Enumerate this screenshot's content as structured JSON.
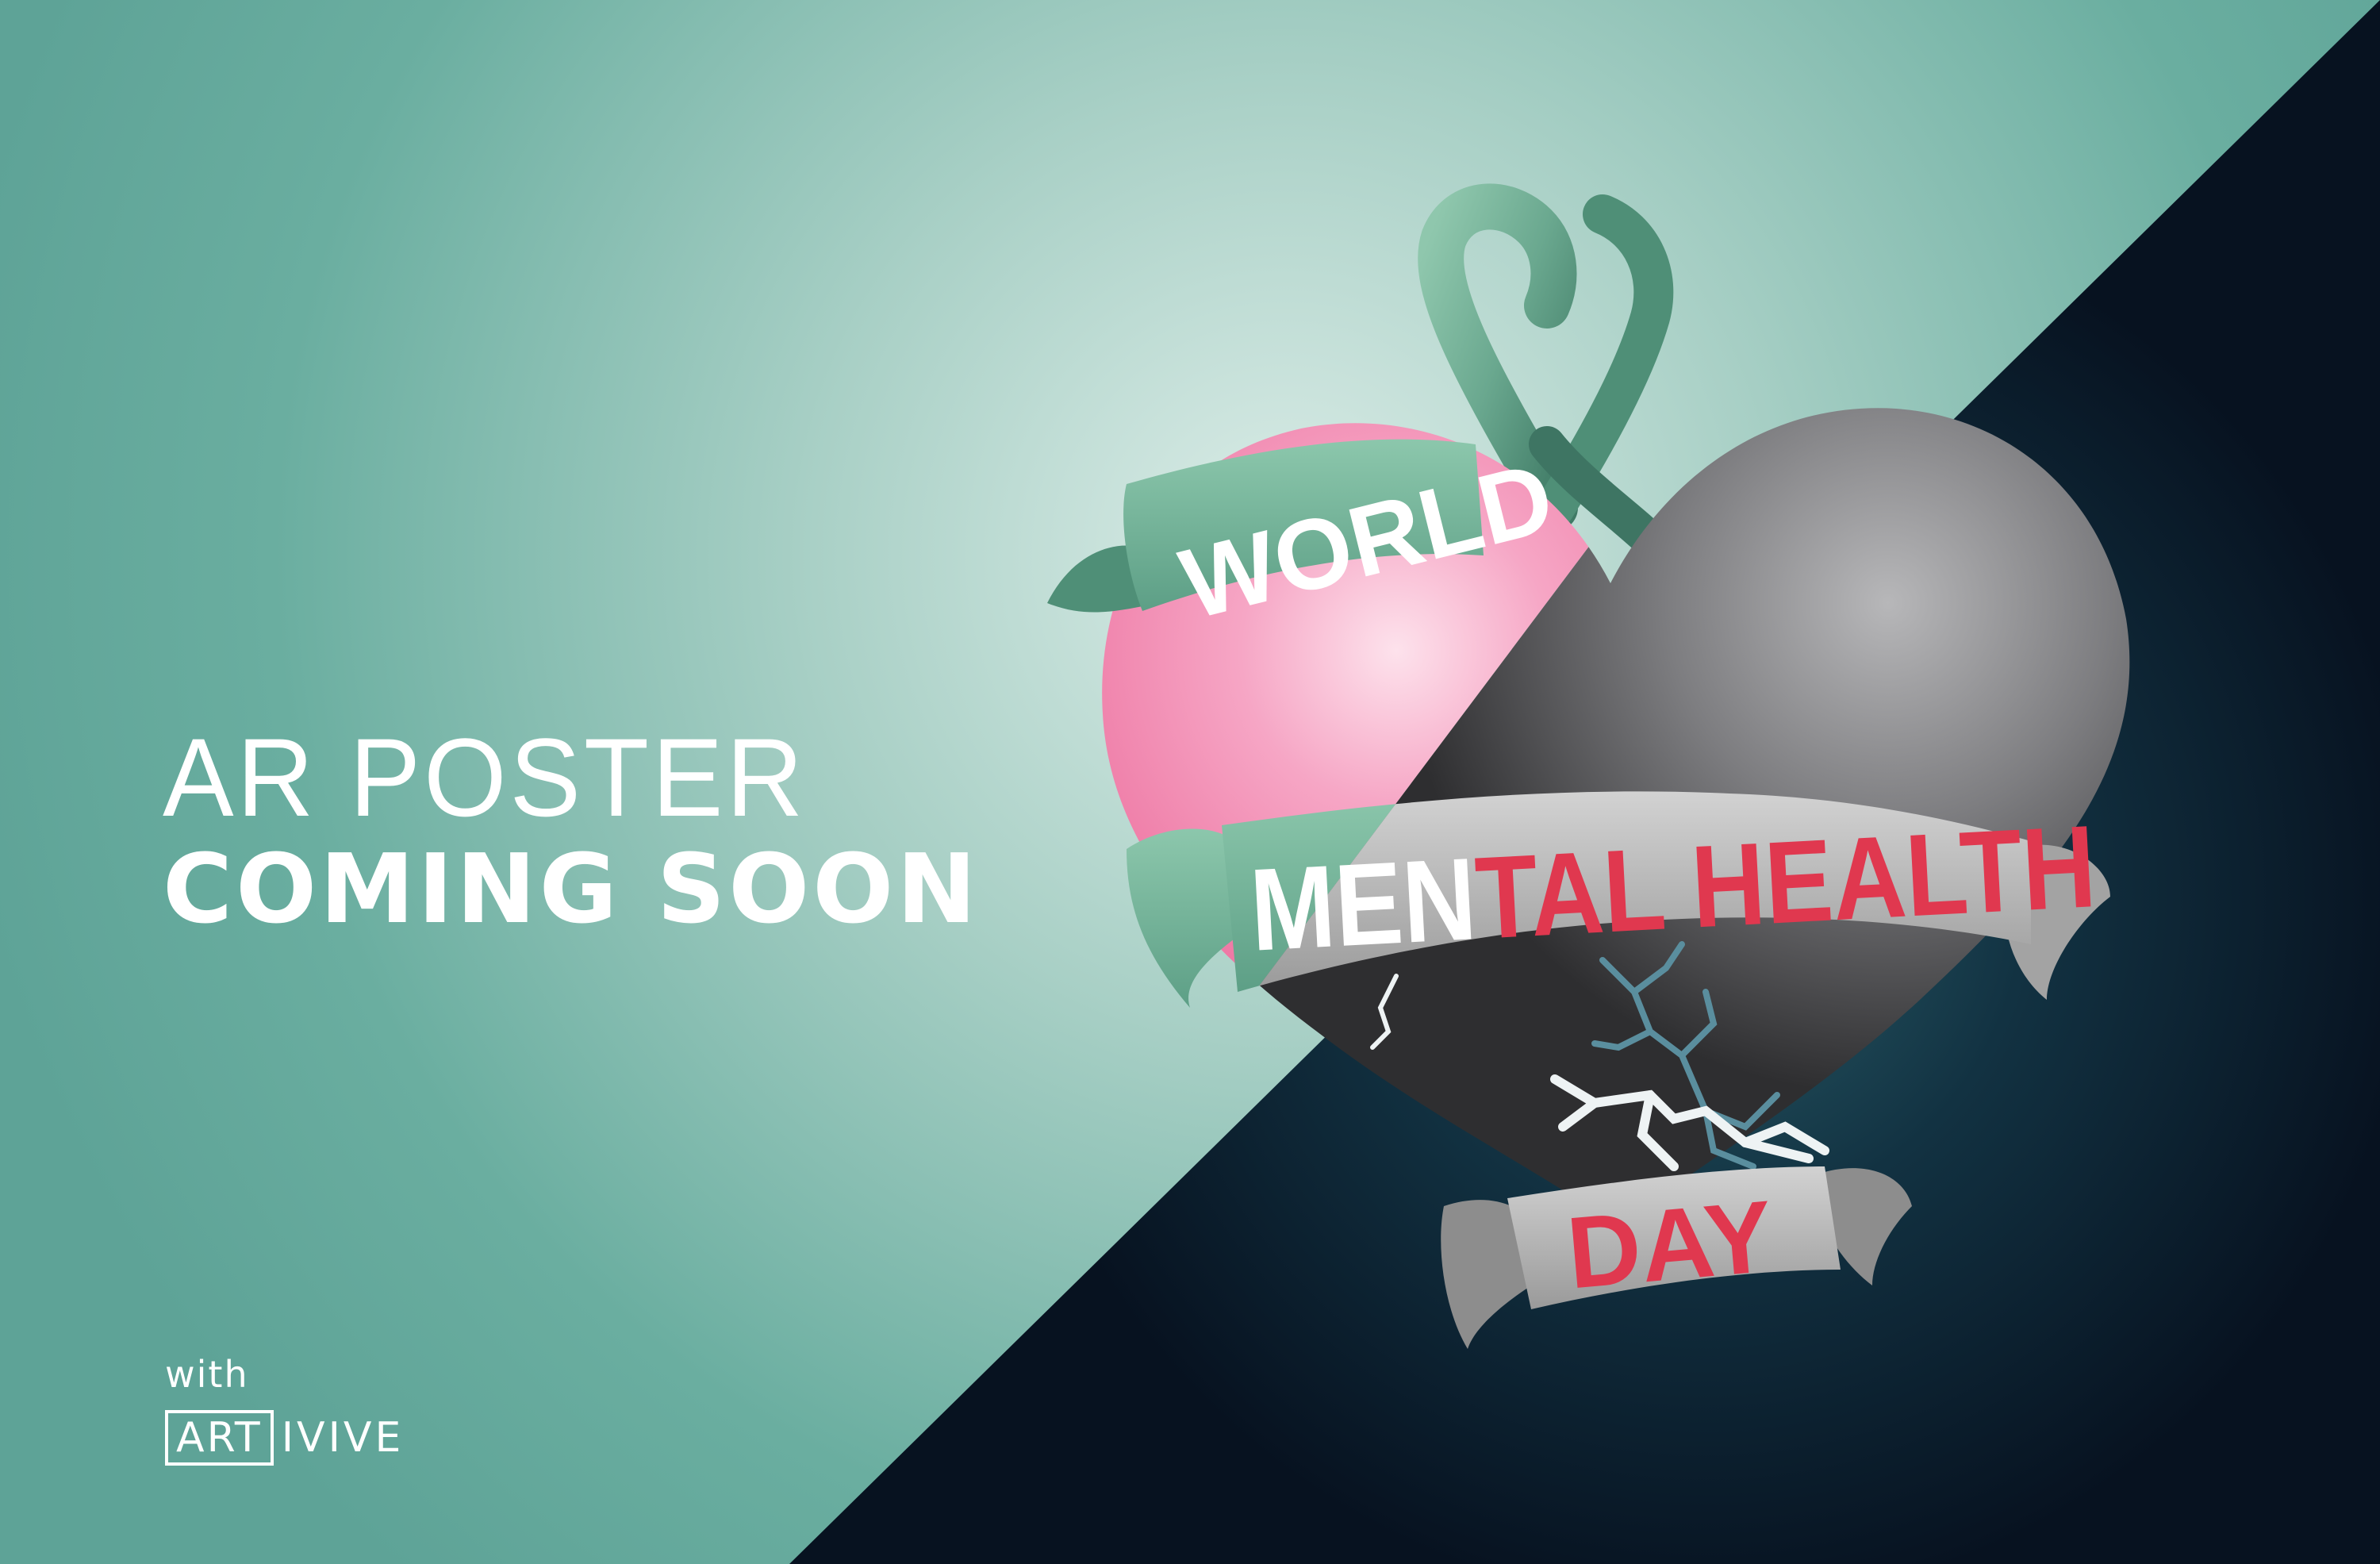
{
  "poster": {
    "headline_line1": "AR POSTER",
    "headline_line2": "COMING SOON",
    "with_label": "with",
    "brand_boxed": "ART",
    "brand_rest": "IVIVE"
  },
  "artwork": {
    "banner_top": "WORLD",
    "banner_middle_part1": "MEN",
    "banner_middle_part2": "TAL HEALTH",
    "banner_bottom": "DAY",
    "icons": [
      "awareness-ribbon-icon",
      "heart-icon",
      "crack-icon"
    ]
  },
  "colors": {
    "teal_background": "#6aaea0",
    "teal_glow": "#d8ebe6",
    "dark_background": "#081522",
    "heart_pink": "#f07aa6",
    "heart_gray": "#6a6a6a",
    "ribbon_green": "#5fa88d",
    "banner_gray": "#b3b3b3",
    "accent_red": "#e0384f",
    "text_white": "#ffffff"
  }
}
